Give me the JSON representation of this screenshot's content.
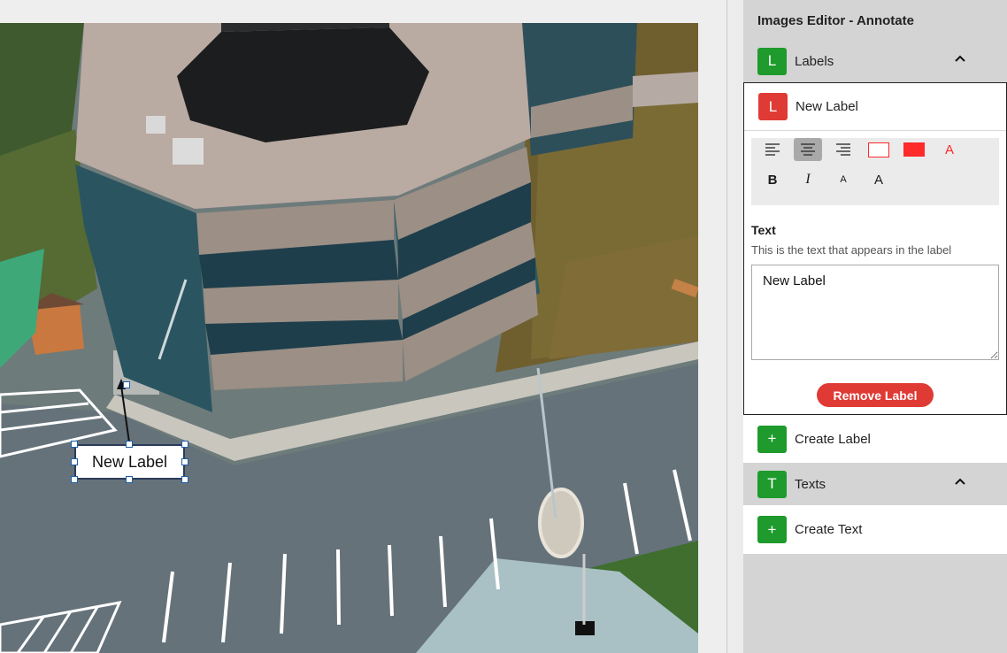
{
  "canvas": {
    "label_text": "New Label",
    "photo_description_icon": "aerial-building-photo"
  },
  "panel": {
    "title": "Images Editor - Annotate",
    "labels_section": {
      "badge": "L",
      "label": "Labels",
      "expanded": true,
      "chevron_icon": "chevron-up-icon"
    },
    "label_item": {
      "badge": "L",
      "name": "New Label",
      "badge_color": "#e03a35",
      "toolbar": {
        "align_left_icon": "align-left-icon",
        "align_center_icon": "align-center-icon",
        "align_right_icon": "align-right-icon",
        "active_alignment": "center",
        "border_color": "#ff2a2a",
        "fill_color": "#ff2a2a",
        "text_color": "#ff2a2a",
        "text_color_glyph": "A",
        "bold_glyph": "B",
        "italic_glyph": "I",
        "small_font_glyph": "A",
        "large_font_glyph": "A"
      },
      "text_field": {
        "title": "Text",
        "help": "This is the text that appears in the label",
        "value": "New Label"
      },
      "remove_button": "Remove Label"
    },
    "create_label": {
      "badge": "+",
      "label": "Create Label"
    },
    "texts_section": {
      "badge": "T",
      "label": "Texts",
      "expanded": true,
      "chevron_icon": "chevron-up-icon"
    },
    "create_text": {
      "badge": "+",
      "label": "Create Text"
    }
  },
  "colors": {
    "green_badge": "#1f9a2c",
    "red_badge": "#e03a35",
    "panel_bg": "#d4d4d4"
  }
}
